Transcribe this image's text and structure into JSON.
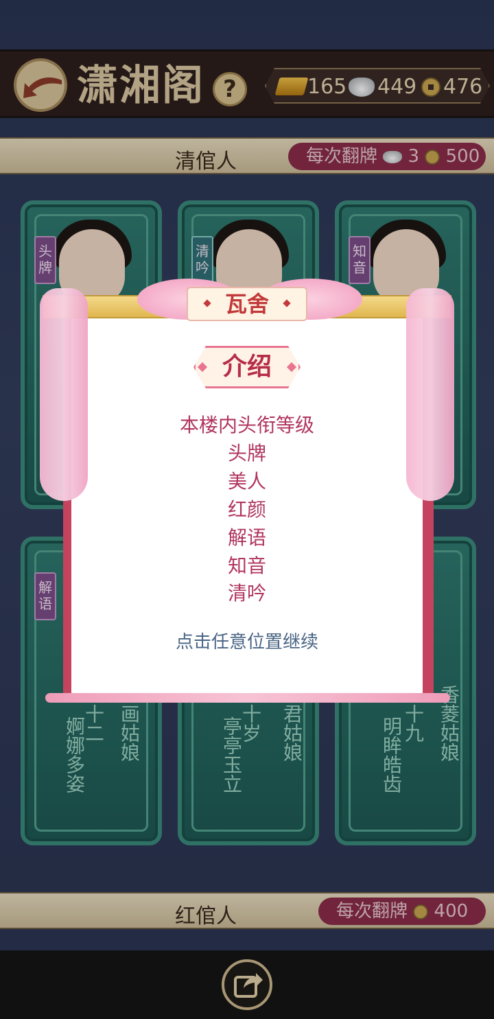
{
  "header": {
    "title": "潇湘阁",
    "help_label": "?",
    "gold": "165",
    "silver": "449",
    "coins": "476"
  },
  "sections": [
    {
      "title": "清倌人",
      "cost_prefix": "每次翻牌",
      "silver_cost": "3",
      "coin_cost": "500"
    },
    {
      "title": "红倌人",
      "cost_prefix": "每次翻牌",
      "coin_cost": "400"
    }
  ],
  "cards_top": [
    {
      "rank": "头牌"
    },
    {
      "rank": "清吟"
    },
    {
      "rank": "知音"
    }
  ],
  "cards_bottom": [
    {
      "rank": "解语",
      "age": "十二",
      "desc": "婀娜多姿",
      "name": "画姑娘"
    },
    {
      "age": "十岁",
      "desc": "亭亭玉立",
      "name": "君姑娘"
    },
    {
      "age": "十九",
      "desc": "明眸皓齿",
      "name": "香菱姑娘"
    }
  ],
  "dialog": {
    "header": "瓦舍",
    "intro_label": "介绍",
    "lines": [
      "本楼内头衔等级",
      "头牌",
      "美人",
      "红颜",
      "解语",
      "知音",
      "清吟"
    ],
    "continue_hint": "点击任意位置继续"
  },
  "icons": {
    "back": "back-arrow-icon",
    "help": "question-icon",
    "gold": "gold-bar-icon",
    "silver": "silver-ingot-icon",
    "coin": "copper-coin-icon",
    "share": "share-icon"
  },
  "colors": {
    "header_bg": "#2e1f1e",
    "card_jade": "#2f7a70",
    "dialog_border": "#c4445f",
    "intro_text": "#b0355e",
    "hint_text": "#4a6585"
  }
}
